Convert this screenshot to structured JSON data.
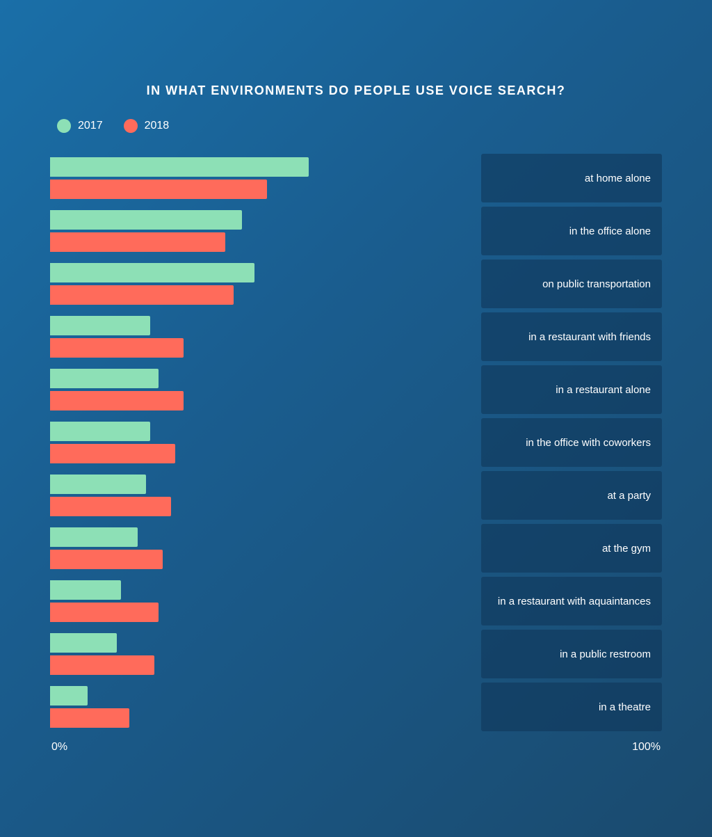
{
  "title": "IN WHAT ENVIRONMENTS DO PEOPLE USE VOICE SEARCH?",
  "legend": {
    "item2017": {
      "label": "2017",
      "color": "#8de0b6"
    },
    "item2018": {
      "label": "2018",
      "color": "#ff6b5b"
    }
  },
  "axis": {
    "min": "0%",
    "max": "100%"
  },
  "bars": [
    {
      "label": "at home alone",
      "pct2017": 62,
      "pct2018": 52
    },
    {
      "label": "in the office alone",
      "pct2017": 46,
      "pct2018": 42
    },
    {
      "label": "on public transportation",
      "pct2017": 49,
      "pct2018": 44
    },
    {
      "label": "in a restaurant with friends",
      "pct2017": 24,
      "pct2018": 32
    },
    {
      "label": "in a restaurant alone",
      "pct2017": 26,
      "pct2018": 32
    },
    {
      "label": "in the office with coworkers",
      "pct2017": 24,
      "pct2018": 30
    },
    {
      "label": "at a party",
      "pct2017": 23,
      "pct2018": 29
    },
    {
      "label": "at the gym",
      "pct2017": 21,
      "pct2018": 27
    },
    {
      "label": "in a restaurant with aquaintances",
      "pct2017": 17,
      "pct2018": 26
    },
    {
      "label": "in a public restroom",
      "pct2017": 16,
      "pct2018": 25
    },
    {
      "label": "in a theatre",
      "pct2017": 9,
      "pct2018": 19
    }
  ]
}
